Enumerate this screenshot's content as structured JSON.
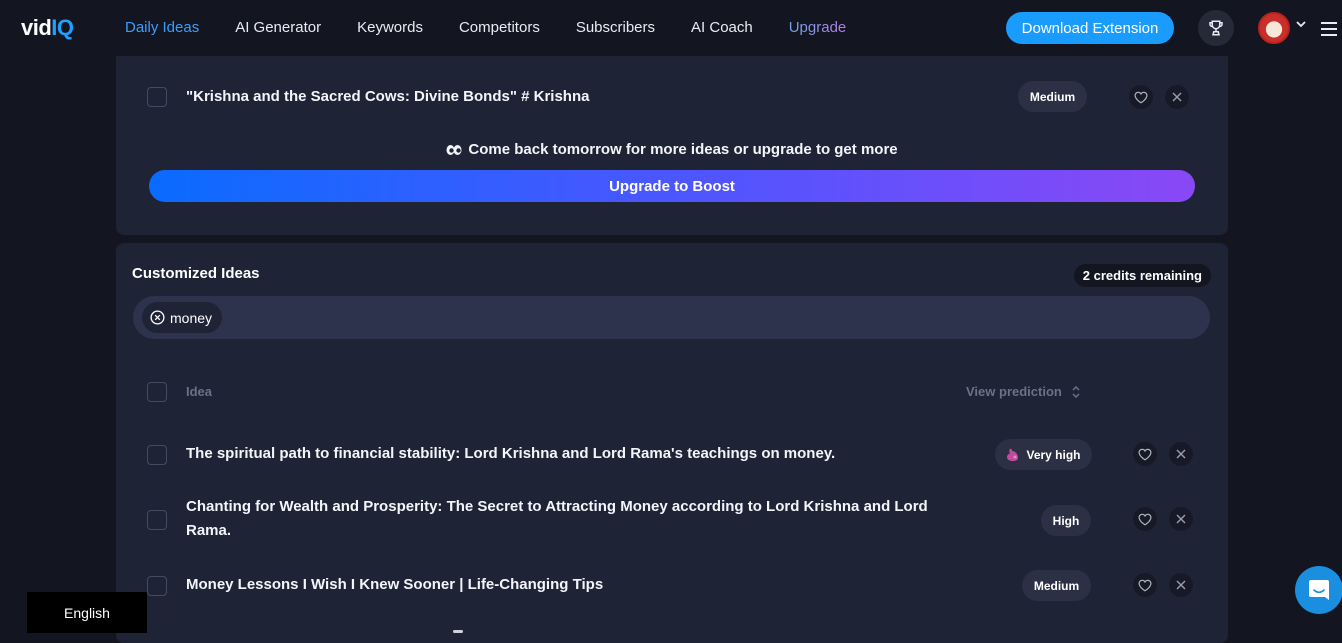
{
  "header": {
    "logo": {
      "part1": "vid",
      "part2": "IQ"
    },
    "nav": [
      {
        "label": "Daily Ideas",
        "active": true
      },
      {
        "label": "AI Generator"
      },
      {
        "label": "Keywords"
      },
      {
        "label": "Competitors"
      },
      {
        "label": "Subscribers"
      },
      {
        "label": "AI Coach"
      },
      {
        "label": "Upgrade"
      }
    ],
    "download_button": "Download Extension",
    "icons": {
      "trophy": "trophy-icon",
      "avatar": "user-avatar",
      "chevron": "chevron-down-icon",
      "menu": "hamburger-menu-icon"
    }
  },
  "daily_ideas": {
    "rows": [
      {
        "text": "\"Krishna and the Sacred Cows: Divine Bonds\" # Krishna",
        "prediction": "Medium"
      }
    ],
    "notice": "Come back tomorrow for more ideas or upgrade to get more",
    "upgrade_button": "Upgrade to Boost"
  },
  "customized_ideas": {
    "title": "Customized Ideas",
    "credits": "2 credits remaining",
    "tags": [
      "money"
    ],
    "columns": {
      "idea": "Idea",
      "prediction": "View prediction"
    },
    "rows": [
      {
        "text": "The spiritual path to financial stability: Lord Krishna and Lord Rama's teachings on money.",
        "prediction": "Very high"
      },
      {
        "text": "Chanting for Wealth and Prosperity: The Secret to Attracting Money according to Lord Krishna and Lord Rama.",
        "prediction": "High"
      },
      {
        "text": "Money Lessons I Wish I Knew Sooner | Life-Changing Tips",
        "prediction": "Medium"
      }
    ]
  },
  "footer": {
    "language": "English"
  },
  "colors": {
    "accent": "#1a9cff",
    "active_nav": "#3b9cff",
    "card_bg": "#1f2336",
    "page_bg": "#131621",
    "gradient_start": "#0a6bff",
    "gradient_end": "#8a48f5"
  }
}
